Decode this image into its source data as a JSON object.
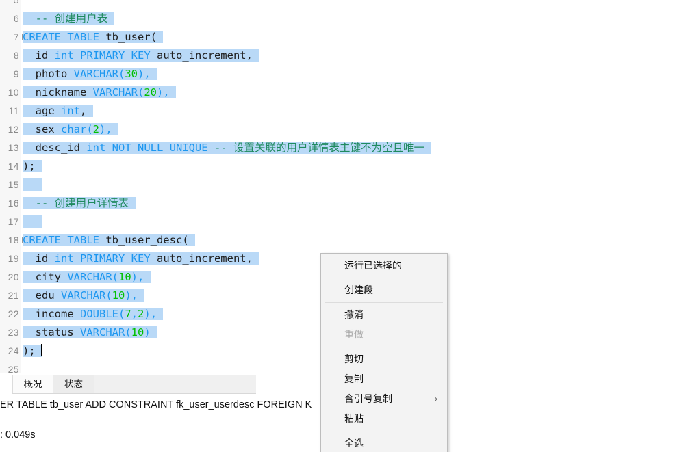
{
  "editor": {
    "first_visible_line": 5,
    "lines": [
      {
        "no": 5,
        "segments": [],
        "selected": false,
        "fold": "none"
      },
      {
        "no": 6,
        "segments": [
          {
            "t": "  ",
            "c": "sel-gap"
          },
          {
            "t": "-- 创建用户表",
            "c": "cmt"
          }
        ],
        "selected": true,
        "fold": "none"
      },
      {
        "no": 7,
        "segments": [
          {
            "t": "CREATE TABLE",
            "c": "kw"
          },
          {
            "t": " tb_user(",
            "c": "id"
          }
        ],
        "selected": true,
        "fold": "start"
      },
      {
        "no": 8,
        "segments": [
          {
            "t": "  id ",
            "c": "id"
          },
          {
            "t": "int PRIMARY KEY",
            "c": "kw"
          },
          {
            "t": " auto_increment,",
            "c": "id"
          }
        ],
        "selected": true,
        "fold": "mid"
      },
      {
        "no": 9,
        "segments": [
          {
            "t": "  photo ",
            "c": "id"
          },
          {
            "t": "VARCHAR(",
            "c": "kw"
          },
          {
            "t": "30",
            "c": "num"
          },
          {
            "t": "),",
            "c": "kw"
          }
        ],
        "selected": true,
        "fold": "mid"
      },
      {
        "no": 10,
        "segments": [
          {
            "t": "  nickname ",
            "c": "id"
          },
          {
            "t": "VARCHAR(",
            "c": "kw"
          },
          {
            "t": "20",
            "c": "num"
          },
          {
            "t": "),",
            "c": "kw"
          }
        ],
        "selected": true,
        "fold": "mid"
      },
      {
        "no": 11,
        "segments": [
          {
            "t": "  age ",
            "c": "id"
          },
          {
            "t": "int",
            "c": "kw"
          },
          {
            "t": ",",
            "c": "id"
          }
        ],
        "selected": true,
        "fold": "mid"
      },
      {
        "no": 12,
        "segments": [
          {
            "t": "  sex ",
            "c": "id"
          },
          {
            "t": "char(",
            "c": "kw"
          },
          {
            "t": "2",
            "c": "num"
          },
          {
            "t": "),",
            "c": "kw"
          }
        ],
        "selected": true,
        "fold": "mid"
      },
      {
        "no": 13,
        "segments": [
          {
            "t": "  desc_id ",
            "c": "id"
          },
          {
            "t": "int NOT NULL UNIQUE",
            "c": "kw"
          },
          {
            "t": " ",
            "c": "id"
          },
          {
            "t": "-- 设置关联的用户详情表主键不为空且唯一",
            "c": "cmt"
          }
        ],
        "selected": true,
        "fold": "mid"
      },
      {
        "no": 14,
        "segments": [
          {
            "t": ");",
            "c": "id"
          }
        ],
        "selected": true,
        "fold": "end"
      },
      {
        "no": 15,
        "segments": [],
        "selected": true,
        "fold": "none"
      },
      {
        "no": 16,
        "segments": [
          {
            "t": "  ",
            "c": "sel-gap"
          },
          {
            "t": "-- 创建用户详情表",
            "c": "cmt"
          }
        ],
        "selected": true,
        "fold": "none"
      },
      {
        "no": 17,
        "segments": [],
        "selected": true,
        "fold": "none"
      },
      {
        "no": 18,
        "segments": [
          {
            "t": "CREATE TABLE",
            "c": "kw"
          },
          {
            "t": " tb_user_desc(",
            "c": "id"
          }
        ],
        "selected": true,
        "fold": "start"
      },
      {
        "no": 19,
        "segments": [
          {
            "t": "  id ",
            "c": "id"
          },
          {
            "t": "int PRIMARY KEY",
            "c": "kw"
          },
          {
            "t": " auto_increment,",
            "c": "id"
          }
        ],
        "selected": true,
        "fold": "mid"
      },
      {
        "no": 20,
        "segments": [
          {
            "t": "  city ",
            "c": "id"
          },
          {
            "t": "VARCHAR(",
            "c": "kw"
          },
          {
            "t": "10",
            "c": "num"
          },
          {
            "t": "),",
            "c": "kw"
          }
        ],
        "selected": true,
        "fold": "mid"
      },
      {
        "no": 21,
        "segments": [
          {
            "t": "  edu ",
            "c": "id"
          },
          {
            "t": "VARCHAR(",
            "c": "kw"
          },
          {
            "t": "10",
            "c": "num"
          },
          {
            "t": "),",
            "c": "kw"
          }
        ],
        "selected": true,
        "fold": "mid"
      },
      {
        "no": 22,
        "segments": [
          {
            "t": "  income ",
            "c": "id"
          },
          {
            "t": "DOUBLE(",
            "c": "kw"
          },
          {
            "t": "7",
            "c": "num"
          },
          {
            "t": ",",
            "c": "kw"
          },
          {
            "t": "2",
            "c": "num"
          },
          {
            "t": "),",
            "c": "kw"
          }
        ],
        "selected": true,
        "fold": "mid"
      },
      {
        "no": 23,
        "segments": [
          {
            "t": "  status ",
            "c": "id"
          },
          {
            "t": "VARCHAR(",
            "c": "kw"
          },
          {
            "t": "10",
            "c": "num"
          },
          {
            "t": ")",
            "c": "kw"
          }
        ],
        "selected": true,
        "fold": "mid"
      },
      {
        "no": 24,
        "segments": [
          {
            "t": ");",
            "c": "id"
          }
        ],
        "selected": true,
        "fold": "end",
        "caret": true
      },
      {
        "no": 25,
        "segments": [],
        "selected": false,
        "fold": "none"
      }
    ]
  },
  "context_menu": {
    "items": [
      {
        "label": "运行已选择的",
        "disabled": false,
        "submenu": false,
        "sep_after": true
      },
      {
        "label": "创建段",
        "disabled": false,
        "submenu": false,
        "sep_after": true
      },
      {
        "label": "撤消",
        "disabled": false,
        "submenu": false,
        "sep_after": false
      },
      {
        "label": "重做",
        "disabled": true,
        "submenu": false,
        "sep_after": true
      },
      {
        "label": "剪切",
        "disabled": false,
        "submenu": false,
        "sep_after": false
      },
      {
        "label": "复制",
        "disabled": false,
        "submenu": false,
        "sep_after": false
      },
      {
        "label": "含引号复制",
        "disabled": false,
        "submenu": true,
        "sep_after": false
      },
      {
        "label": "粘贴",
        "disabled": false,
        "submenu": false,
        "sep_after": true
      },
      {
        "label": "全选",
        "disabled": false,
        "submenu": false,
        "sep_after": false
      }
    ],
    "submenu_arrow": "›"
  },
  "bottom_panel": {
    "tabs": [
      {
        "label": "概况",
        "active": true
      },
      {
        "label": "状态",
        "active": false
      }
    ],
    "status_sql": "ER TABLE tb_user ADD CONSTRAINT fk_user_userdesc FOREIGN K                tb_user_desc(id)",
    "status_time": ": 0.049s"
  },
  "colors": {
    "selection": "#b9d9f7",
    "keyword": "#1d97f0",
    "number": "#00c000",
    "comment": "#1f8a5f",
    "identifier": "#202020",
    "gutter_bg": "#f7f7f7",
    "gutter_text": "#8a8a8a",
    "menu_bg": "#f3f3f3",
    "menu_border": "#bdbdbd"
  }
}
